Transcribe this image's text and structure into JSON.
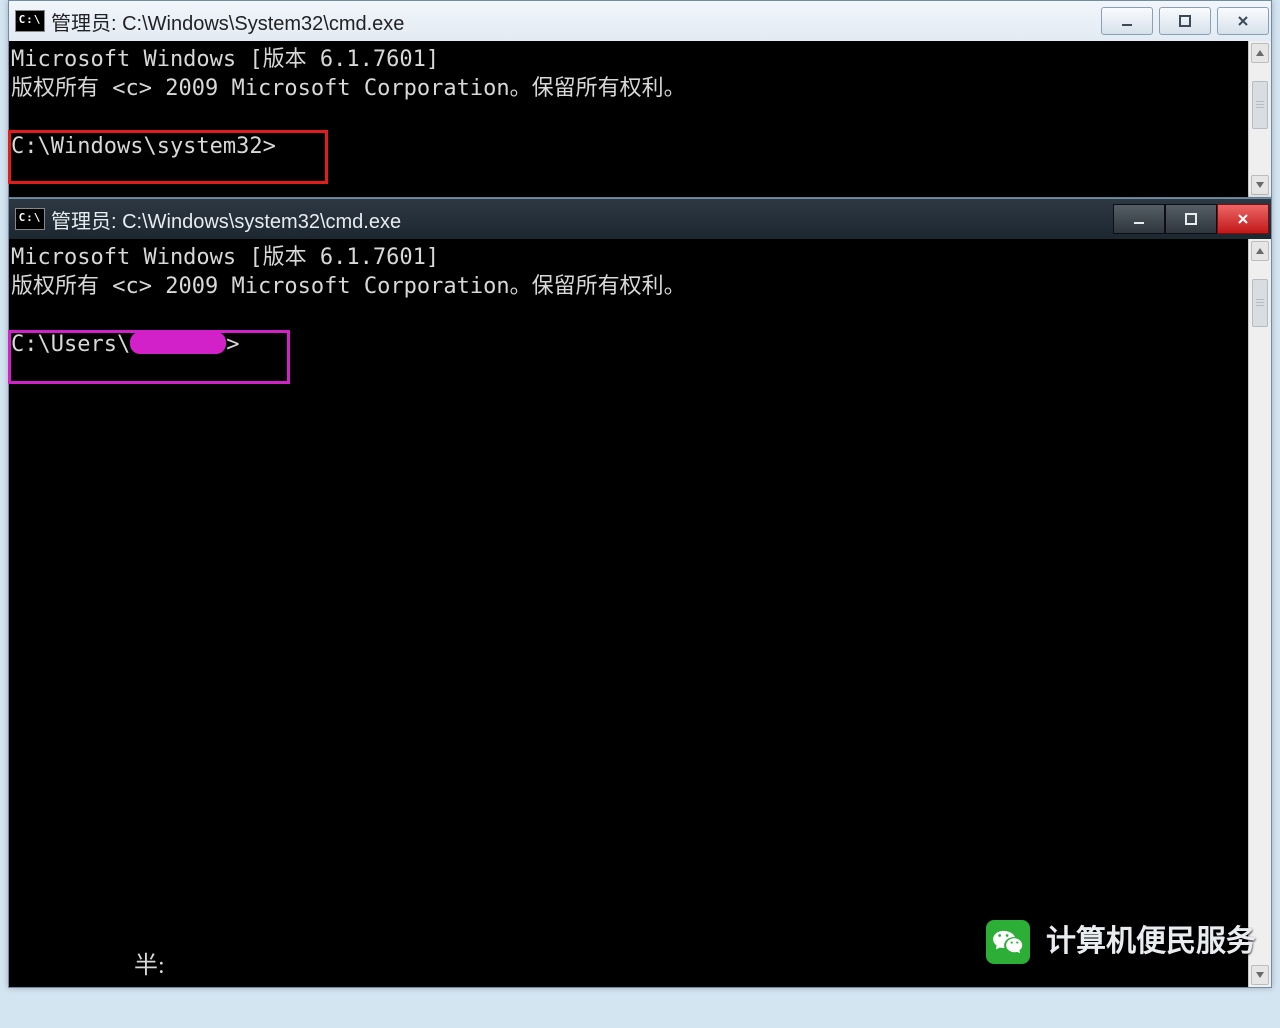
{
  "top_window": {
    "icon_label": "C:\\",
    "title": "管理员: C:\\Windows\\System32\\cmd.exe",
    "body_line1": "Microsoft Windows [版本 6.1.7601]",
    "body_line2": "版权所有 <c> 2009 Microsoft Corporation。保留所有权利。",
    "prompt": "C:\\Windows\\system32>"
  },
  "bottom_window": {
    "icon_label": "C:\\",
    "title": "管理员: C:\\Windows\\system32\\cmd.exe",
    "body_line1": "Microsoft Windows [版本 6.1.7601]",
    "body_line2": "版权所有 <c> 2009 Microsoft Corporation。保留所有权利。",
    "prompt_prefix": "C:\\Users\\",
    "prompt_suffix": ">"
  },
  "ime_hint": "半:",
  "watermark_text": "计算机便民服务",
  "colors": {
    "highlight_red": "#e21b1b",
    "highlight_magenta": "#d321c9",
    "close_red": "#c21818"
  }
}
